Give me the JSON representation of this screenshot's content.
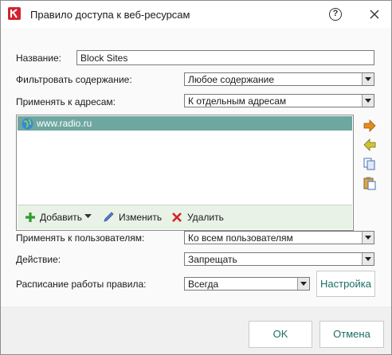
{
  "window": {
    "title": "Правило доступа к веб-ресурсам",
    "help_label": "?"
  },
  "form": {
    "name_label": "Название:",
    "name_value": "Block Sites",
    "filter_label": "Фильтровать содержание:",
    "filter_value": "Любое содержание",
    "apply_addresses_label": "Применять к адресам:",
    "apply_addresses_value": "К отдельным адресам",
    "address_list": [
      "www.radio.ru"
    ],
    "toolbar": {
      "add_label": "Добавить",
      "edit_label": "Изменить",
      "delete_label": "Удалить"
    },
    "apply_users_label": "Применять к пользователям:",
    "apply_users_value": "Ко всем пользователям",
    "action_label": "Действие:",
    "action_value": "Запрещать",
    "schedule_label": "Расписание работы правила:",
    "schedule_value": "Всегда",
    "settings_button": "Настройка"
  },
  "footer": {
    "ok_label": "OK",
    "cancel_label": "Отмена"
  },
  "colors": {
    "accent": "#1b6e66",
    "selection": "#6ea6a0",
    "toolbar_bg": "#e9f2e6",
    "logo": "#d2242f"
  },
  "icons": [
    "kaspersky-logo-icon",
    "help-icon",
    "close-icon",
    "globe-icon",
    "add-icon",
    "dropdown-arrow-icon",
    "edit-icon",
    "delete-icon",
    "move-right-icon",
    "move-left-icon",
    "copy-icon",
    "paste-icon"
  ]
}
